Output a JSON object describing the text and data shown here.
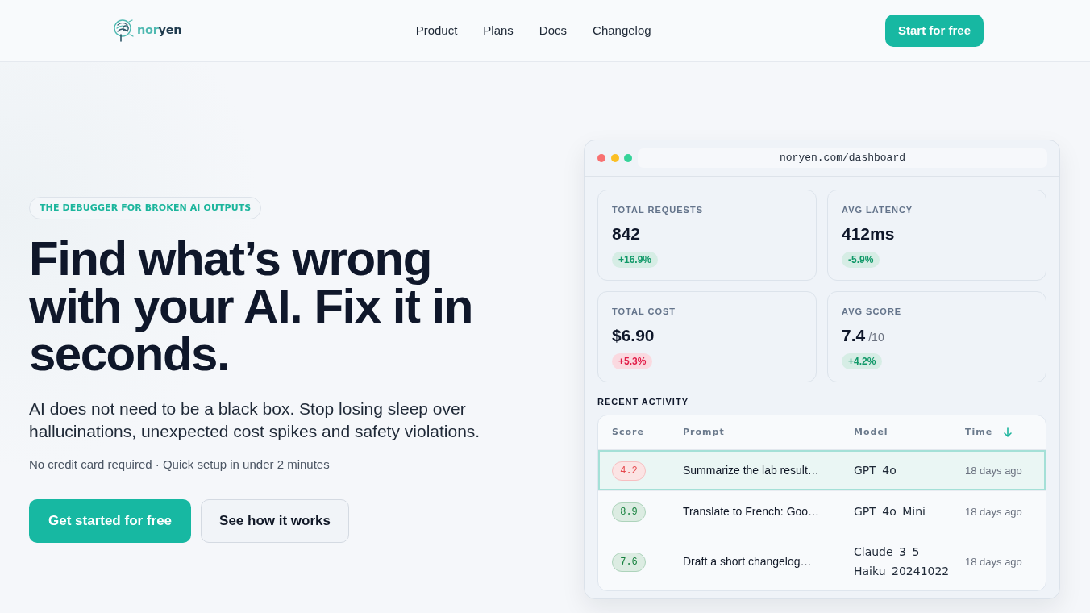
{
  "nav": {
    "logo": [
      {
        "text": "nor",
        "accent": true
      },
      {
        "text": "yen",
        "accent": false
      }
    ],
    "links": [
      "Product",
      "Plans",
      "Docs",
      "Changelog"
    ],
    "cta": "Start for free"
  },
  "hero": {
    "eyebrow": "THE DEBUGGER FOR BROKEN AI OUTPUTS",
    "headline": "Find what’s wrong with your AI. Fix it in seconds.",
    "subtitle": "AI does not need to be a black box. Stop losing sleep over hallucinations, unexpected cost spikes and safety violations.",
    "note": "No credit card required · Quick setup in under 2 minutes",
    "buttons": [
      {
        "label": "Get started for free",
        "kind": "primary"
      },
      {
        "label": "See how it works",
        "kind": "secondary"
      }
    ]
  },
  "dashboard": {
    "url": "noryen.com/dashboard",
    "stats": [
      {
        "label": "TOTAL REQUESTS",
        "value": "842",
        "change": "+16.9%",
        "color": "#109868"
      },
      {
        "label": "AVG LATENCY",
        "value": "412ms",
        "change": "-5.9%",
        "color": "#109868"
      },
      {
        "label": "TOTAL COST",
        "value": "$6.90",
        "change": "+5.3%",
        "color": "#e11d48"
      },
      {
        "label": "AVG SCORE",
        "value": "7.4",
        "suffix": "/10",
        "change": "+4.2%",
        "color": "#109868"
      }
    ],
    "activity_title": "RECENT ACTIVITY",
    "table": {
      "columns": [
        {
          "label": "Score",
          "sorted": false
        },
        {
          "label": "Prompt",
          "sorted": false
        },
        {
          "label": "Model",
          "sorted": false
        },
        {
          "label": "Time",
          "sorted": true
        }
      ],
      "rows": [
        {
          "score": "4.2",
          "color": "#e5484d",
          "prompt": "Summarize the lab result…",
          "model": "GPT 4o",
          "time": "18 days ago",
          "selected": true
        },
        {
          "score": "8.9",
          "color": "#15803d",
          "prompt": "Translate to French: Goo…",
          "model": "GPT 4o Mini",
          "time": "18 days ago",
          "selected": false
        },
        {
          "score": "7.6",
          "color": "#15803d",
          "prompt": "Draft a short changelog…",
          "model": "Claude 3 5 Haiku 20241022",
          "time": "18 days ago",
          "selected": false
        }
      ]
    }
  }
}
